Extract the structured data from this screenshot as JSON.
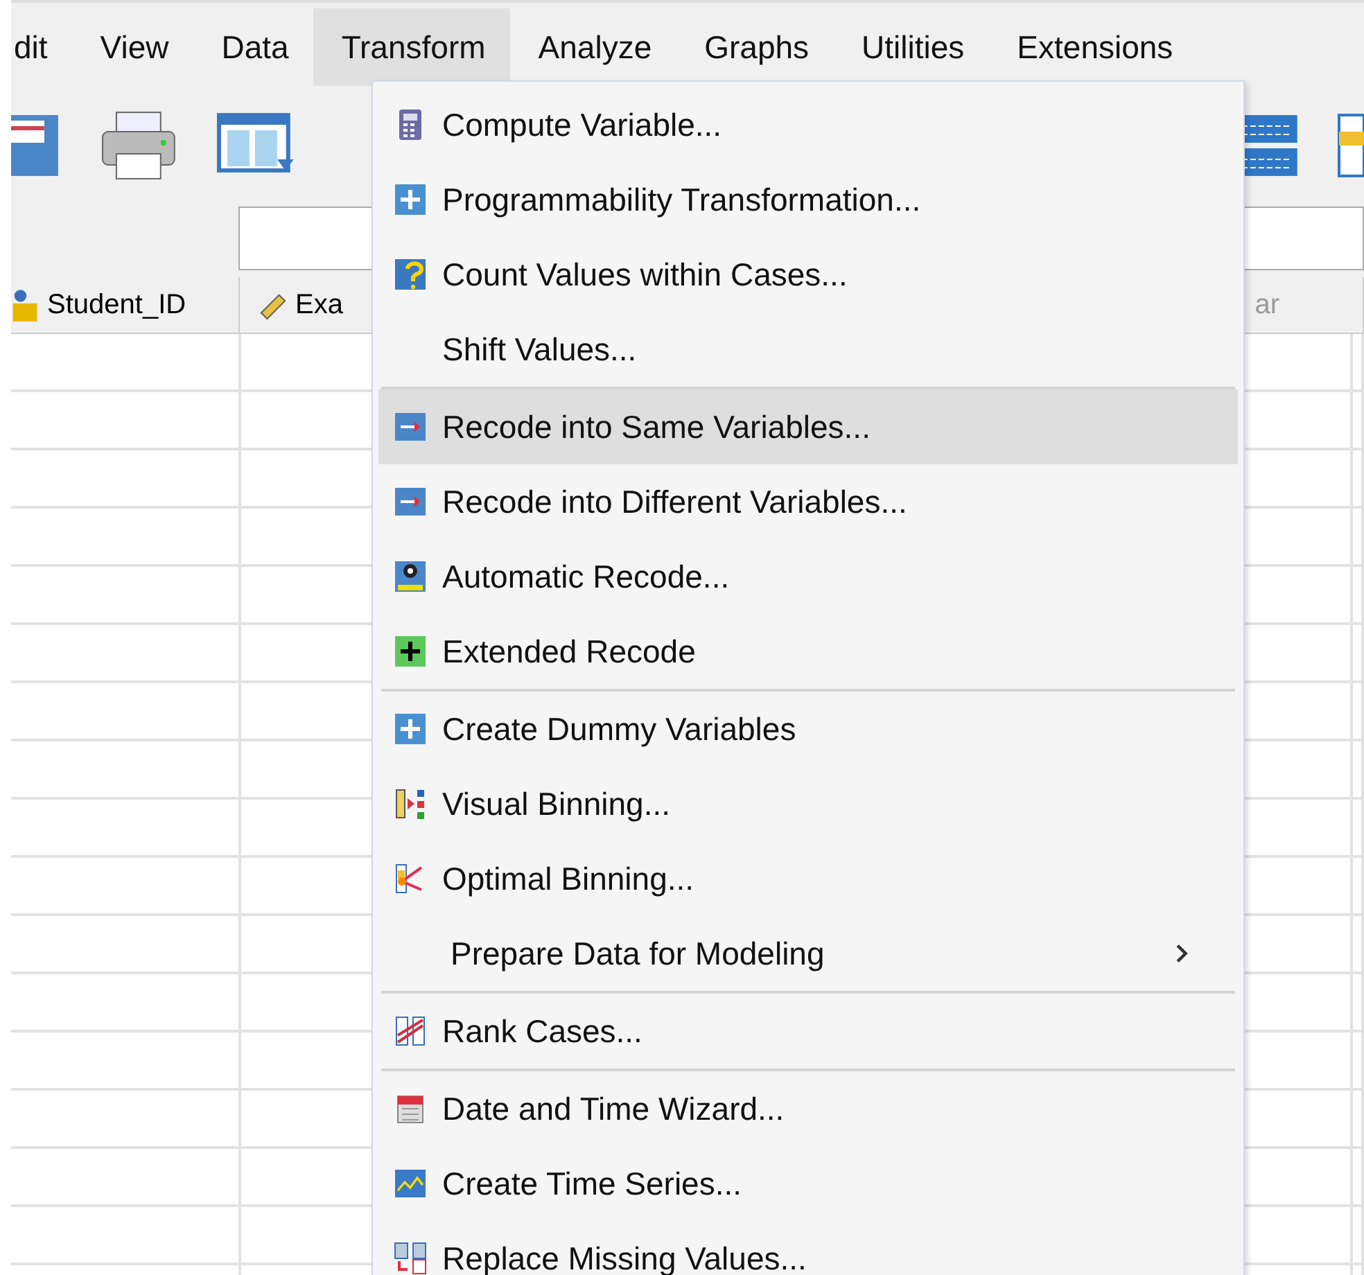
{
  "menu_bar": [
    {
      "label": "dit",
      "selected": false
    },
    {
      "label": "View",
      "selected": false
    },
    {
      "label": "Data",
      "selected": false
    },
    {
      "label": "Transform",
      "selected": true
    },
    {
      "label": "Analyze",
      "selected": false
    },
    {
      "label": "Graphs",
      "selected": false
    },
    {
      "label": "Utilities",
      "selected": false
    },
    {
      "label": "Extensions",
      "selected": false
    }
  ],
  "columns": [
    {
      "label": "Student_ID",
      "kind": "nominal"
    },
    {
      "label": "Exa",
      "kind": "scale"
    },
    {
      "label": "ar",
      "kind": "plain"
    }
  ],
  "transform_menu": [
    {
      "kind": "item",
      "label": "Compute Variable...",
      "selected": false,
      "submenu": false
    },
    {
      "kind": "item",
      "label": "Programmability Transformation...",
      "selected": false,
      "submenu": false
    },
    {
      "kind": "item",
      "label": "Count Values within Cases...",
      "selected": false,
      "submenu": false
    },
    {
      "kind": "item",
      "label": "Shift Values...",
      "selected": false,
      "submenu": false
    },
    {
      "kind": "separator"
    },
    {
      "kind": "item",
      "label": "Recode into Same Variables...",
      "selected": true,
      "submenu": false
    },
    {
      "kind": "item",
      "label": "Recode into Different Variables...",
      "selected": false,
      "submenu": false
    },
    {
      "kind": "item",
      "label": "Automatic Recode...",
      "selected": false,
      "submenu": false
    },
    {
      "kind": "item",
      "label": "Extended Recode",
      "selected": false,
      "submenu": false
    },
    {
      "kind": "separator"
    },
    {
      "kind": "item",
      "label": "Create Dummy Variables",
      "selected": false,
      "submenu": false
    },
    {
      "kind": "item",
      "label": "Visual Binning...",
      "selected": false,
      "submenu": false
    },
    {
      "kind": "item",
      "label": "Optimal Binning...",
      "selected": false,
      "submenu": false
    },
    {
      "kind": "item",
      "label": "Prepare Data for Modeling",
      "selected": false,
      "submenu": true
    },
    {
      "kind": "separator"
    },
    {
      "kind": "item",
      "label": "Rank Cases...",
      "selected": false,
      "submenu": false
    },
    {
      "kind": "separator"
    },
    {
      "kind": "item",
      "label": "Date and Time Wizard...",
      "selected": false,
      "submenu": false
    },
    {
      "kind": "item",
      "label": "Create Time Series...",
      "selected": false,
      "submenu": false
    },
    {
      "kind": "item",
      "label": "Replace Missing Values...",
      "selected": false,
      "submenu": false
    }
  ]
}
